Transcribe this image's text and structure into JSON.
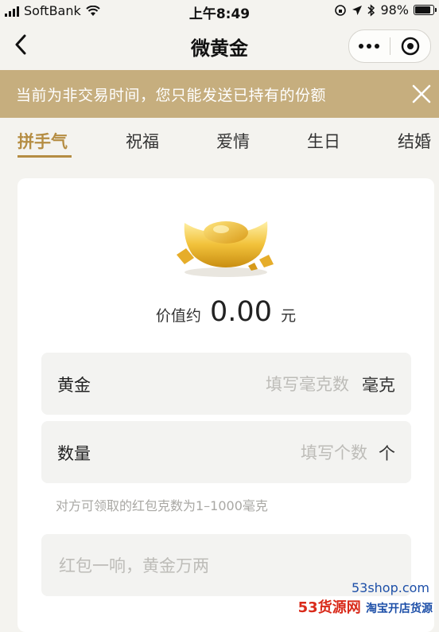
{
  "status_bar": {
    "carrier": "SoftBank",
    "time": "上午8:49",
    "battery": "98%"
  },
  "nav": {
    "title": "微黄金"
  },
  "notice": {
    "text": "当前为非交易时间，您只能发送已持有的份额"
  },
  "tabs": [
    {
      "label": "拼手气",
      "active": true
    },
    {
      "label": "祝福",
      "active": false
    },
    {
      "label": "爱情",
      "active": false
    },
    {
      "label": "生日",
      "active": false
    },
    {
      "label": "结婚",
      "active": false
    }
  ],
  "value": {
    "prefix": "价值约",
    "amount": "0.00",
    "unit": "元"
  },
  "gold_field": {
    "label": "黄金",
    "placeholder": "填写毫克数",
    "unit": "毫克"
  },
  "quantity_field": {
    "label": "数量",
    "placeholder": "填写个数",
    "unit": "个"
  },
  "hint": "对方可领取的红包克数为1–1000毫克",
  "message": {
    "placeholder": "红包一响，黄金万两"
  },
  "watermark": {
    "site": "53shop.com",
    "brand_main": "53货源网",
    "brand_sub": "淘宝开店货源"
  },
  "colors": {
    "accent": "#b58d43",
    "notice_bg": "#c6ae7e",
    "page_bg": "#f4f3ef"
  }
}
